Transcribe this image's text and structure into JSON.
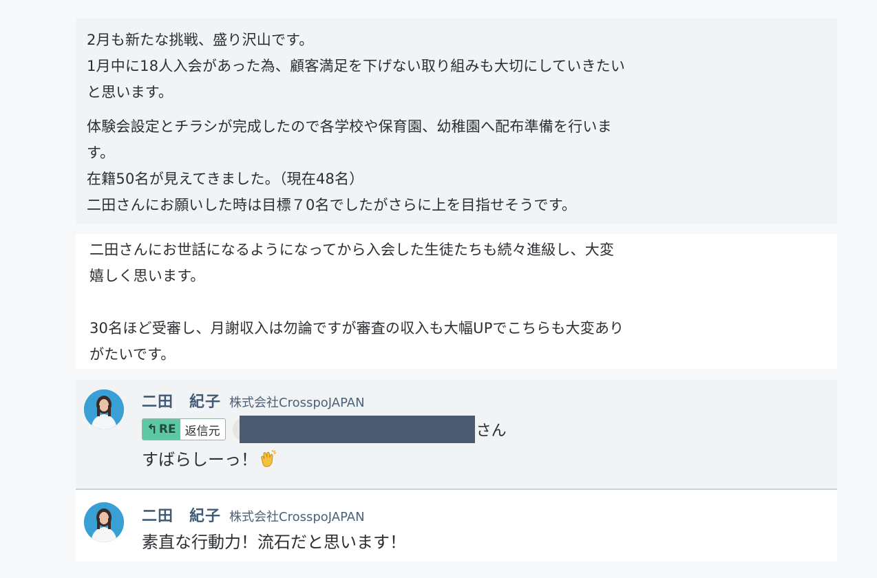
{
  "post": {
    "paragraph1": [
      "2月も新たな挑戦、盛り沢山です。",
      "1月中に18人入会があった為、顧客満足を下げない取り組みも大切にしていきたい",
      "と思います。"
    ],
    "paragraph2": [
      "体験会設定とチラシが完成したので各学校や保育園、幼稚園へ配布準備を行いま",
      "す。",
      "在籍50名が見えてきました。（現在48名）",
      "二田さんにお願いした時は目標７0名でしたがさらに上を目指せそうです。"
    ],
    "paragraph3": [
      "二田さんにお世話になるようになってから入会した生徒たちも続々進級し、大変",
      "嬉しく思います。",
      "",
      "30名ほど受審し、月謝収入は勿論ですが審査の収入も大幅UPでこちらも大変あり",
      "がたいです。"
    ]
  },
  "comments": [
    {
      "author": "二田　紀子",
      "company": "株式会社CrosspoJAPAN",
      "reply_tag": "RE",
      "reply_source_label": "返信元",
      "reply_suffix": "さん",
      "text": "すばらしーっ！",
      "emoji_icon": "clapping-hands-icon"
    },
    {
      "author": "二田　紀子",
      "company": "株式会社CrosspoJAPAN",
      "text": "素直な行動力！流石だと思います！"
    }
  ],
  "colors": {
    "author": "#3f5a75",
    "re_badge": "#5cc9a4",
    "redaction": "#4d5b70",
    "avatar_bg": "#3a9fd4"
  }
}
